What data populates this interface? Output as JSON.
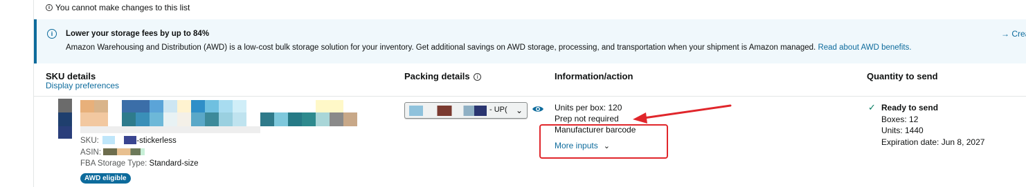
{
  "notice": {
    "text": "You cannot make changes to this list"
  },
  "banner": {
    "title": "Lower your storage fees by up to 84%",
    "body": "Amazon Warehousing and Distribution (AWD) is a low-cost bulk storage solution for your inventory. Get additional savings on AWD storage, processing, and transportation when your shipment is Amazon managed.",
    "link": "Read about AWD benefits.",
    "action": "→ Crea",
    "accent_color": "#0d6b9c"
  },
  "headers": {
    "sku": "SKU details",
    "display_prefs": "Display preferences",
    "packing": "Packing details",
    "info": "Information/action",
    "qty": "Quantity to send"
  },
  "sku": {
    "sku_label": "SKU:",
    "sku_value": "-stickerless",
    "asin_label": "ASIN:",
    "fba_label": "FBA Storage Type:",
    "fba_value": "Standard-size",
    "badge": "AWD eligible"
  },
  "packing": {
    "selected_suffix": "- UP("
  },
  "info": {
    "units_per_box": "Units per box: 120",
    "prep": "Prep not required",
    "barcode": "Manufacturer barcode",
    "more_inputs": "More inputs"
  },
  "quantity": {
    "status": "Ready to send",
    "boxes": "Boxes: 12",
    "units": "Units: 1440",
    "expiration": "Expiration date: Jun 8, 2027"
  },
  "colors": {
    "annotation": "#e0262b",
    "success": "#067d62"
  }
}
